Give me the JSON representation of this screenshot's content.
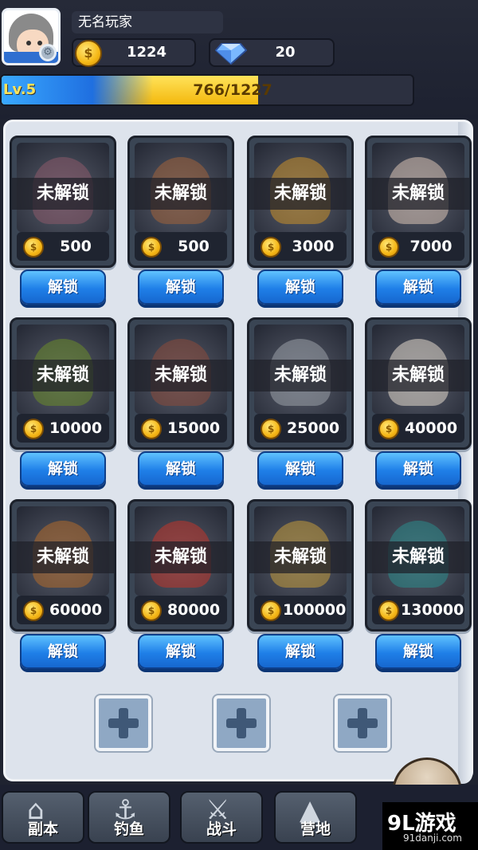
{
  "player": {
    "name": "无名玩家",
    "level_label": "Lv.5",
    "exp_text": "766/1227",
    "exp_progress": 0.624
  },
  "resources": {
    "gold": "1224",
    "diamonds": "20"
  },
  "cards": [
    {
      "status": "未解锁",
      "price": "500",
      "button": "解锁",
      "color": "#8a5a6a"
    },
    {
      "status": "未解锁",
      "price": "500",
      "button": "解锁",
      "color": "#a0623a"
    },
    {
      "status": "未解锁",
      "price": "3000",
      "button": "解锁",
      "color": "#c9902a"
    },
    {
      "status": "未解锁",
      "price": "7000",
      "button": "解锁",
      "color": "#d9c3b5"
    },
    {
      "status": "未解锁",
      "price": "10000",
      "button": "解锁",
      "color": "#6a8a2a"
    },
    {
      "status": "未解锁",
      "price": "15000",
      "button": "解锁",
      "color": "#8a4a3a"
    },
    {
      "status": "未解锁",
      "price": "25000",
      "button": "解锁",
      "color": "#9aa0a8"
    },
    {
      "status": "未解锁",
      "price": "40000",
      "button": "解锁",
      "color": "#e2d8cc"
    },
    {
      "status": "未解锁",
      "price": "60000",
      "button": "解锁",
      "color": "#b06a2a"
    },
    {
      "status": "未解锁",
      "price": "80000",
      "button": "解锁",
      "color": "#c0352a"
    },
    {
      "status": "未解锁",
      "price": "100000",
      "button": "解锁",
      "color": "#c29a3a"
    },
    {
      "status": "未解锁",
      "price": "130000",
      "button": "解锁",
      "color": "#2a8a8a"
    }
  ],
  "bottom_nav": [
    {
      "label": "副本",
      "icon": "gate-icon"
    },
    {
      "label": "钓鱼",
      "icon": "fishing-hook-icon"
    },
    {
      "label": "战斗",
      "icon": "crossed-swords-icon"
    },
    {
      "label": "营地",
      "icon": "tent-icon"
    }
  ],
  "watermark": {
    "main": "9L游戏",
    "sub": "91danji.com"
  }
}
